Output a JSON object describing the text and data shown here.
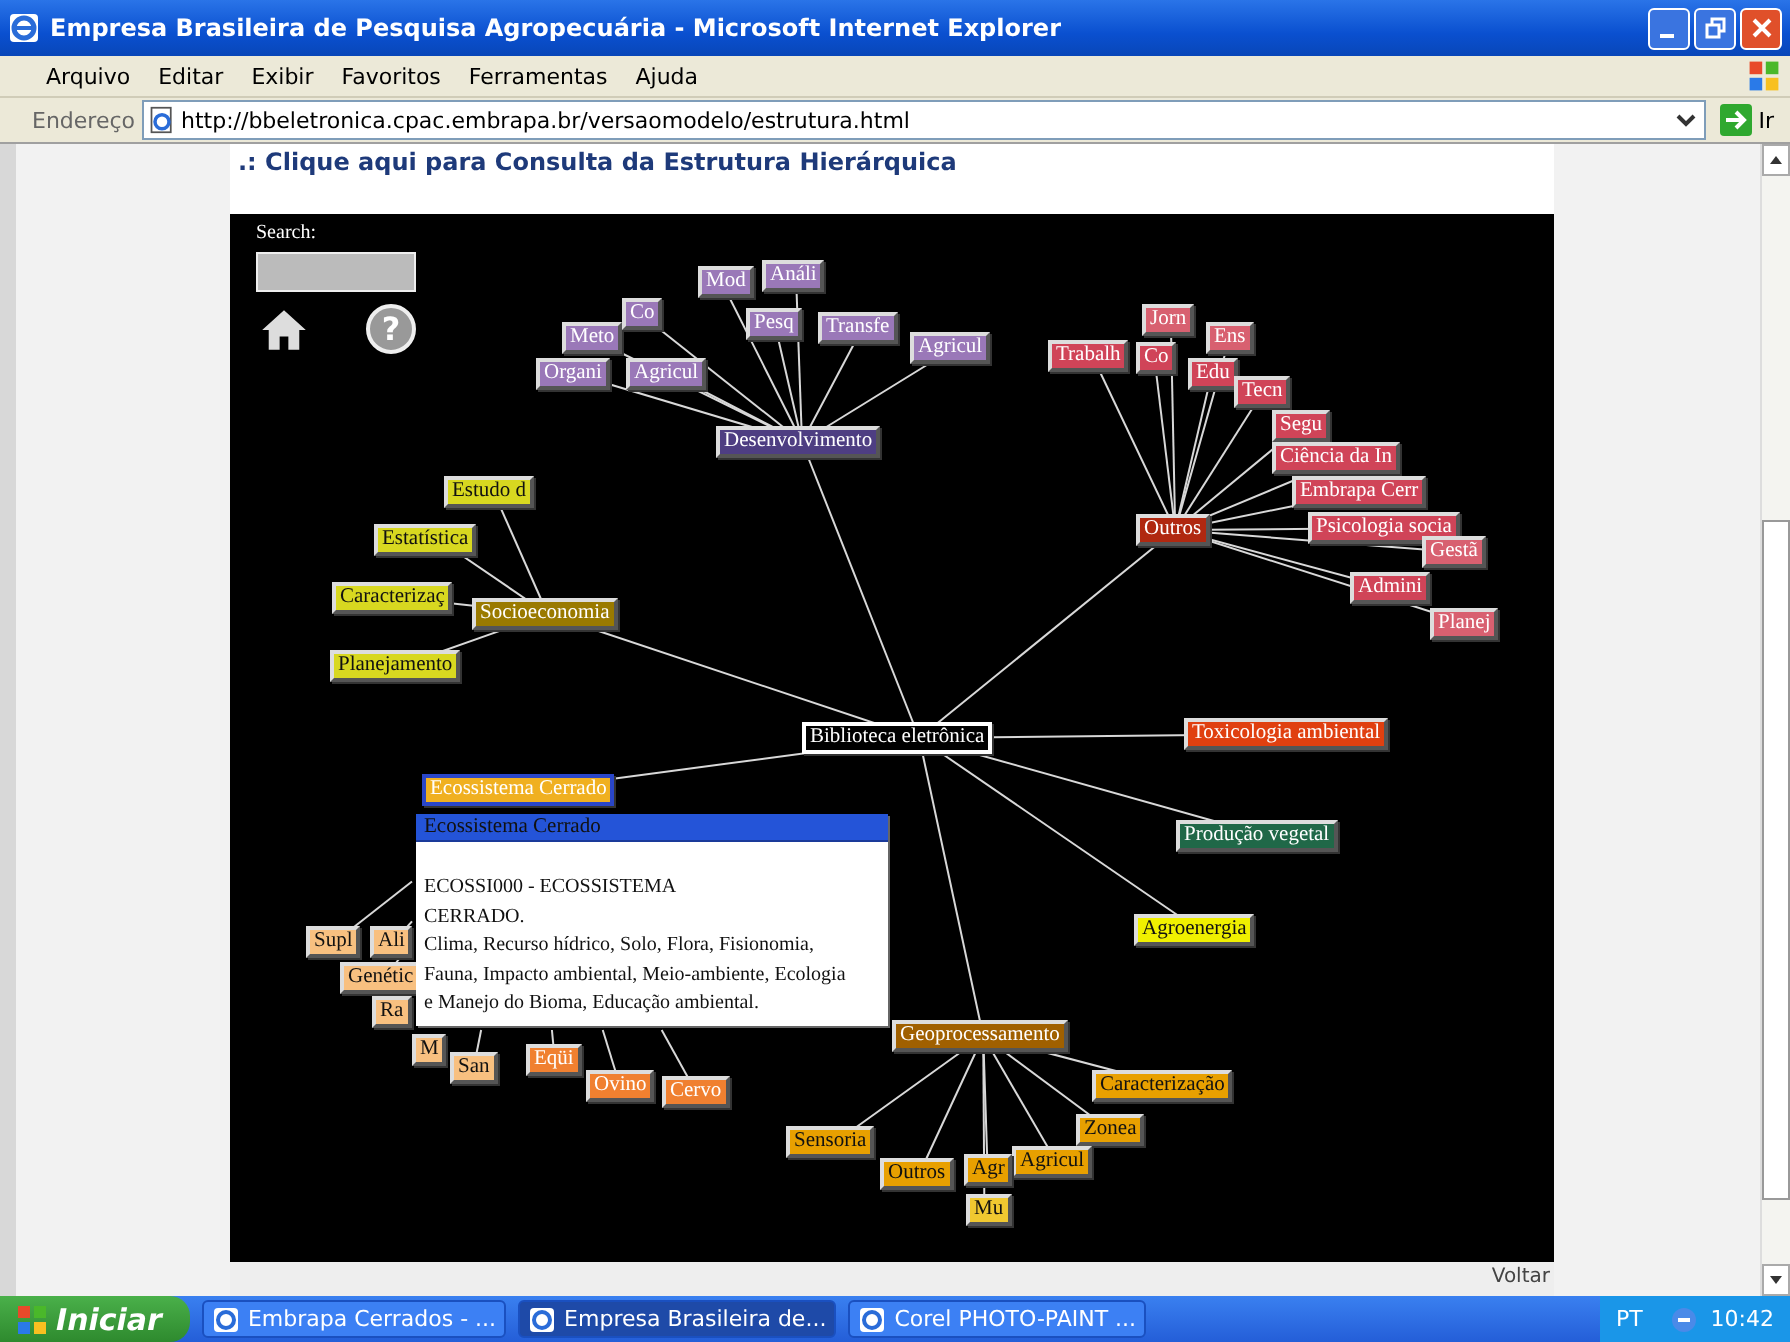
{
  "window": {
    "title": "Empresa Brasileira de Pesquisa Agropecuária - Microsoft Internet Explorer"
  },
  "menu": [
    "Arquivo",
    "Editar",
    "Exibir",
    "Favoritos",
    "Ferramentas",
    "Ajuda"
  ],
  "address_bar": {
    "label": "Endereço",
    "url": "http://bbeletronica.cpac.embrapa.br/versaomodelo/estrutura.html",
    "go": "Ir"
  },
  "page": {
    "heading": ".: Clique aqui para Consulta da Estrutura Hierárquica",
    "search_label": "Search:",
    "help_button": "?",
    "back_link": "Voltar"
  },
  "graph": {
    "label": "Biblioteca eletrônica",
    "color": "#000000",
    "selected": false,
    "children": [
      {
        "label": "Desenvolvimento",
        "color": "#4e3e82",
        "selected": false,
        "children": [
          {
            "label": "Agricul",
            "color": "#9a78b8",
            "selected": false
          },
          {
            "label": "Organi",
            "color": "#9a78b8",
            "selected": false
          },
          {
            "label": "Meto",
            "color": "#9a78b8",
            "selected": false
          },
          {
            "label": "Co",
            "color": "#9a78b8",
            "selected": false
          },
          {
            "label": "Mod",
            "color": "#9a78b8",
            "selected": false
          },
          {
            "label": "Análi",
            "color": "#9a78b8",
            "selected": false
          },
          {
            "label": "Pesq",
            "color": "#9a78b8",
            "selected": false
          },
          {
            "label": "Transfe",
            "color": "#9a78b8",
            "selected": false
          },
          {
            "label": "Agricul",
            "color": "#9a78b8",
            "selected": false
          }
        ]
      },
      {
        "label": "Outros",
        "color": "#b02810",
        "selected": false,
        "children": [
          {
            "label": "Trabalh",
            "color": "#d04458",
            "selected": false
          },
          {
            "label": "Jorn",
            "color": "#d86070",
            "selected": false
          },
          {
            "label": "Co",
            "color": "#d04458",
            "selected": false
          },
          {
            "label": "Ens",
            "color": "#d86070",
            "selected": false
          },
          {
            "label": "Edu",
            "color": "#d04458",
            "selected": false
          },
          {
            "label": "Tecn",
            "color": "#d04458",
            "selected": false
          },
          {
            "label": "Segu",
            "color": "#d04458",
            "selected": false
          },
          {
            "label": "Ciência da In",
            "color": "#d04458",
            "selected": false
          },
          {
            "label": "Embrapa Cerr",
            "color": "#d04458",
            "selected": false
          },
          {
            "label": "Psicologia socia",
            "color": "#d04458",
            "selected": false
          },
          {
            "label": "Admini",
            "color": "#d04458",
            "selected": false
          },
          {
            "label": "Gestã",
            "color": "#d86070",
            "selected": false
          },
          {
            "label": "Planej",
            "color": "#d86070",
            "selected": false
          }
        ]
      },
      {
        "label": "Socioeconomia",
        "color": "#9a7a00",
        "selected": false,
        "children": [
          {
            "label": "Estudo d",
            "color": "#d8d820",
            "selected": false
          },
          {
            "label": "Estatística",
            "color": "#d8d820",
            "selected": false
          },
          {
            "label": "Caracterizaç",
            "color": "#d8d820",
            "selected": false
          },
          {
            "label": "Planejamento",
            "color": "#d8d820",
            "selected": false
          }
        ]
      },
      {
        "label": "Toxicologia ambiental",
        "color": "#e04010",
        "selected": false
      },
      {
        "label": "Produção vegetal",
        "color": "#206848",
        "selected": false
      },
      {
        "label": "Agroenergia",
        "color": "#f0f000",
        "selected": false
      },
      {
        "label": "Geoprocessamento",
        "color": "#a06000",
        "selected": false,
        "children": [
          {
            "label": "Caracterização",
            "color": "#e8a000",
            "selected": false
          },
          {
            "label": "Zonea",
            "color": "#e8a000",
            "selected": false
          },
          {
            "label": "Agricul",
            "color": "#e8a000",
            "selected": false
          },
          {
            "label": "Agr",
            "color": "#e8a000",
            "selected": false
          },
          {
            "label": "Mu",
            "color": "#f0c830",
            "selected": false
          },
          {
            "label": "Outros",
            "color": "#e8a000",
            "selected": false
          },
          {
            "label": "Sensoria",
            "color": "#e8a000",
            "selected": false
          }
        ]
      },
      {
        "label": "Ecossistema Cerrado",
        "color": "#f0b020",
        "selected": true,
        "children": [
          {
            "label": "Supl",
            "color": "#f8c080",
            "selected": false
          },
          {
            "label": "Ali",
            "color": "#f8c080",
            "selected": false
          },
          {
            "label": "Genétic",
            "color": "#f8c080",
            "selected": false
          },
          {
            "label": "Ra",
            "color": "#f8c080",
            "selected": false
          },
          {
            "label": "M",
            "color": "#f8c080",
            "selected": false
          },
          {
            "label": "San",
            "color": "#f8c080",
            "selected": false
          },
          {
            "label": "Eqüi",
            "color": "#f08030",
            "selected": false
          },
          {
            "label": "Ovino",
            "color": "#f08030",
            "selected": false
          },
          {
            "label": "Cervo",
            "color": "#f08030",
            "selected": false
          }
        ]
      }
    ]
  },
  "tooltip": {
    "title": "Ecossistema Cerrado",
    "lines": [
      "ECOSSI000 - ECOSSISTEMA",
      "CERRADO.",
      "Clima, Recurso hídrico, Solo, Flora, Fisionomia,",
      "Fauna, Impacto ambiental, Meio-ambiente, Ecologia",
      "e Manejo do Bioma, Educação ambiental."
    ]
  },
  "taskbar": {
    "start": "Iniciar",
    "tasks": [
      {
        "label": "Embrapa Cerrados - ...",
        "selected": false
      },
      {
        "label": "Empresa Brasileira de...",
        "selected": true
      },
      {
        "label": "Corel PHOTO-PAINT ...",
        "selected": false
      }
    ],
    "language": "PT",
    "time": "10:42"
  }
}
